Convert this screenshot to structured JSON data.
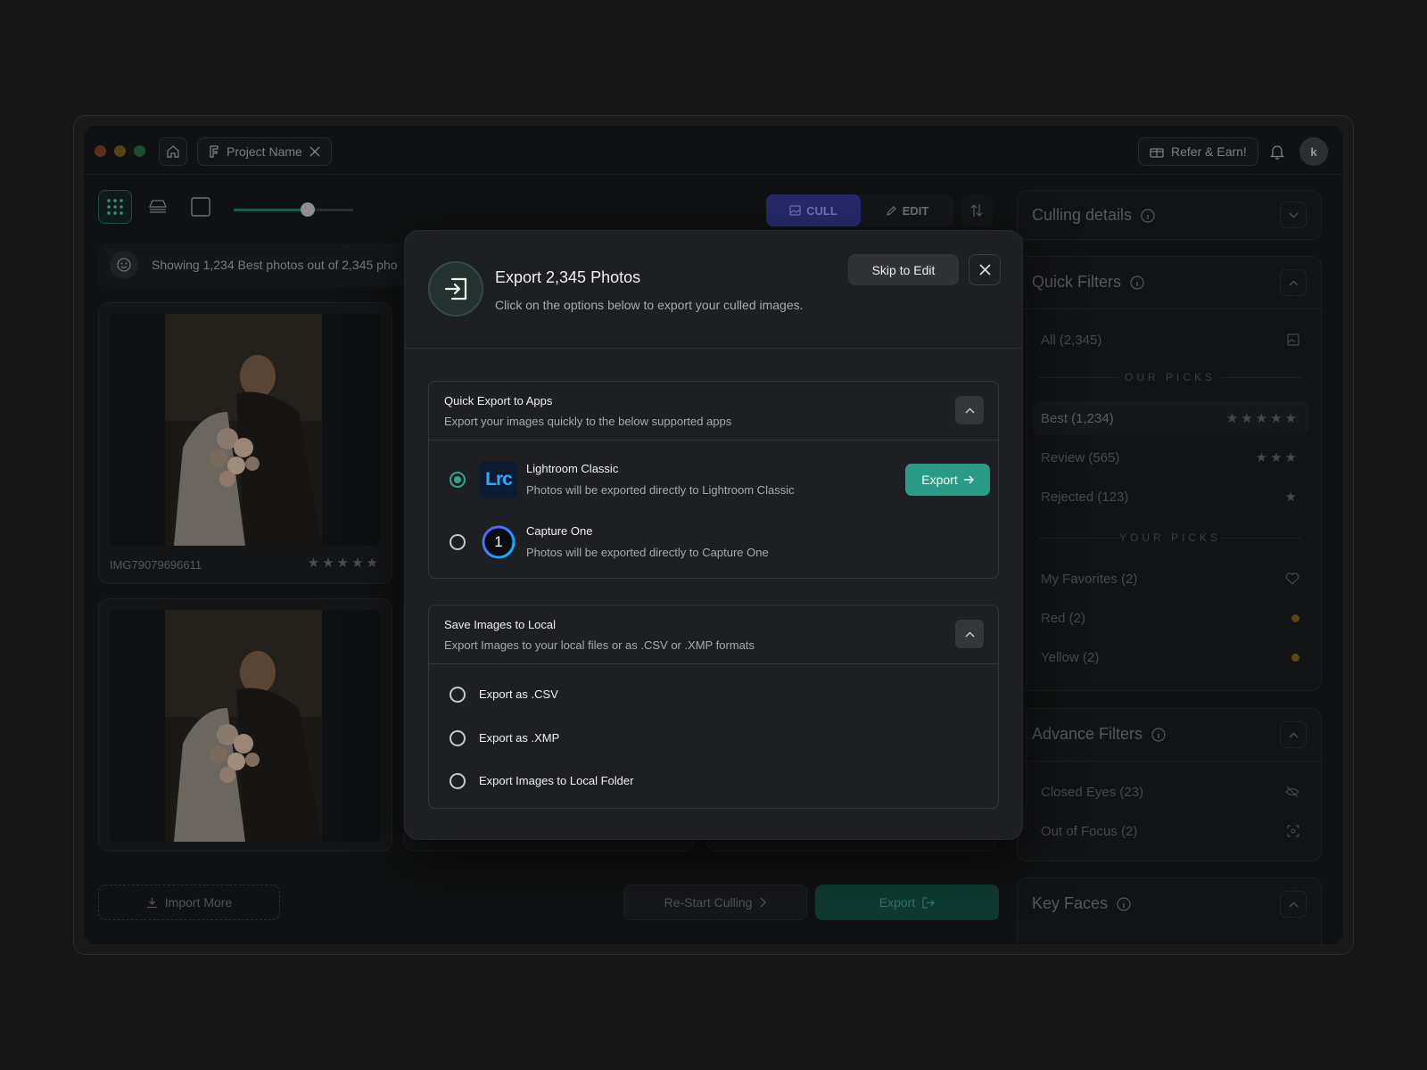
{
  "titlebar": {
    "tab_label": "Project Name",
    "refer_label": "Refer & Earn!",
    "avatar_initial": "k"
  },
  "toolbar": {
    "zoom_level": 0.62,
    "cull_label": "CULL",
    "edit_label": "EDIT"
  },
  "gallery": {
    "showing_text": "Showing 1,234 Best photos out of 2,345 pho",
    "photos": [
      {
        "label": "IMG79079696611",
        "stars": "★★★★★"
      }
    ],
    "import_label": "Import More",
    "restart_label": "Re-Start Culling",
    "export_label": "Export"
  },
  "sidebar": {
    "culling_details": "Culling details",
    "quick_filters": {
      "title": "Quick Filters",
      "all": "All (2,345)",
      "our_picks": "OUR PICKS",
      "best": "Best (1,234)",
      "best_stars": "★★★★★",
      "review": "Review (565)",
      "review_stars": "★★★",
      "rejected": "Rejected (123)",
      "rejected_stars": "★",
      "your_picks": "YOUR PICKS",
      "favorites": "My Favorites (2)",
      "red": "Red (2)",
      "yellow": "Yellow (2)"
    },
    "advance_filters": {
      "title": "Advance Filters",
      "closed_eyes": "Closed Eyes (23)",
      "out_of_focus": "Out of Focus (2)"
    },
    "key_faces": "Key Faces"
  },
  "modal": {
    "title": "Export 2,345 Photos",
    "subtitle": "Click on the options below to export your culled images.",
    "skip_label": "Skip to Edit",
    "quick_export": {
      "title": "Quick Export to Apps",
      "desc": "Export your images quickly to the below supported apps",
      "apps": [
        {
          "logo": "Lrc",
          "name": "Lightroom Classic",
          "desc": "Photos will be exported directly to Lightroom Classic",
          "selected": true
        },
        {
          "logo": "1",
          "name": "Capture One",
          "desc": "Photos will be exported directly to Capture One",
          "selected": false
        }
      ],
      "export_label": "Export"
    },
    "save_local": {
      "title": "Save Images to Local",
      "desc": "Export Images to your local files or as .CSV or .XMP formats",
      "options": [
        "Export as .CSV",
        "Export as .XMP",
        "Export Images to Local Folder"
      ]
    }
  },
  "colors": {
    "accent": "#2a9c85",
    "cull_active": "#27296a"
  }
}
